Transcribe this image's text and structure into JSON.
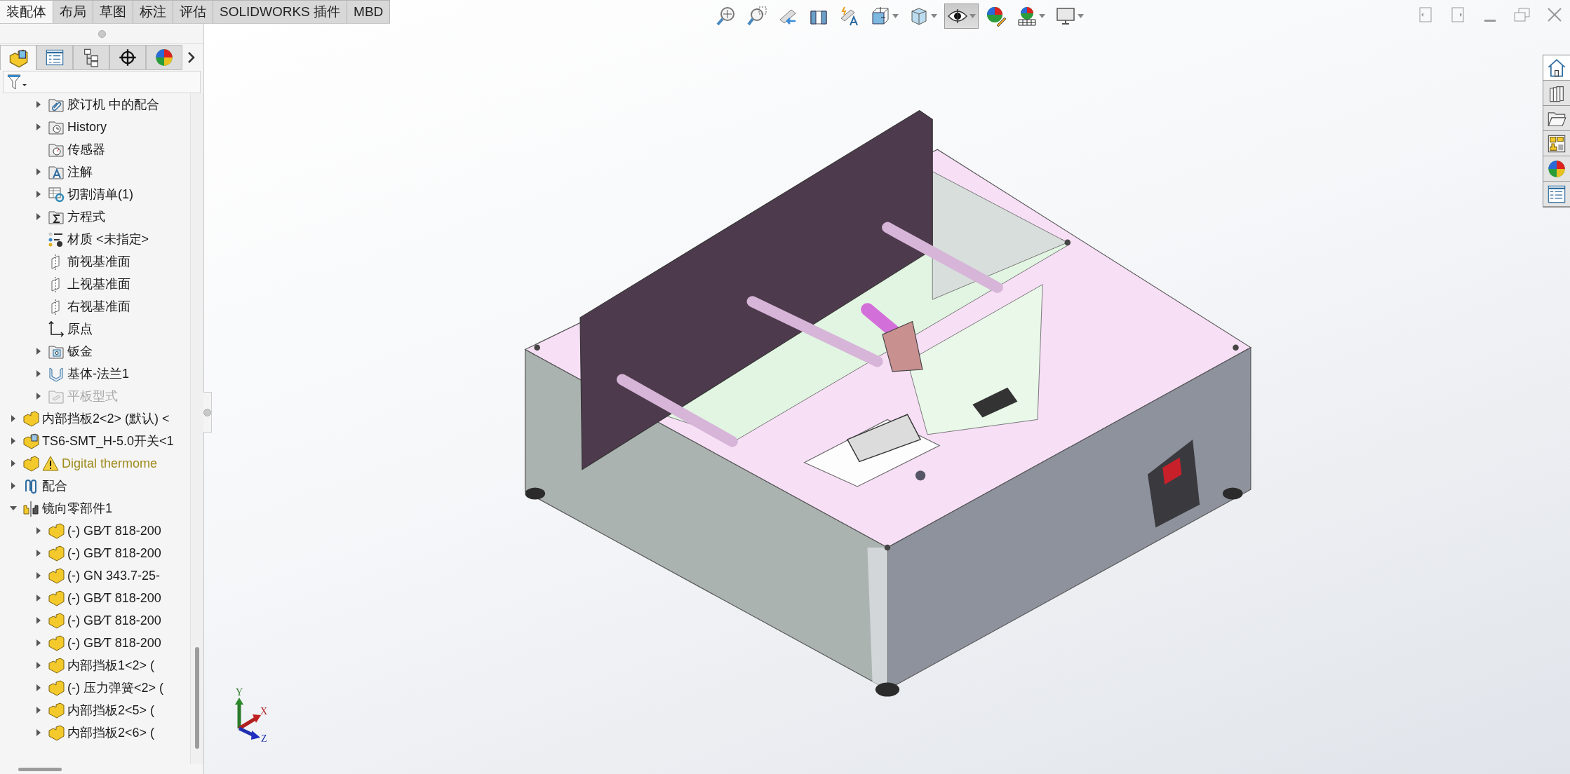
{
  "command_tabs": [
    {
      "label": "装配体",
      "selected": true
    },
    {
      "label": "布局",
      "selected": false
    },
    {
      "label": "草图",
      "selected": false
    },
    {
      "label": "标注",
      "selected": false
    },
    {
      "label": "评估",
      "selected": false
    },
    {
      "label": "SOLIDWORKS 插件",
      "selected": false
    },
    {
      "label": "MBD",
      "selected": false
    }
  ],
  "manager_tabs": [
    {
      "kind": "feature-tree",
      "selected": true
    },
    {
      "kind": "property",
      "selected": false
    },
    {
      "kind": "configuration",
      "selected": false
    },
    {
      "kind": "dimxpert",
      "selected": false
    },
    {
      "kind": "appearance",
      "selected": false
    }
  ],
  "tree": [
    {
      "children": [
        {
          "label": "胶订机 中的配合",
          "kind": "mates-folder",
          "expanded": false
        },
        {
          "label": "History",
          "kind": "history-folder",
          "expanded": false
        },
        {
          "label": "传感器",
          "kind": "sensor-folder"
        },
        {
          "label": "注解",
          "kind": "annotation-folder",
          "expanded": false
        },
        {
          "label": "切割清单(1)",
          "kind": "cutlist",
          "expanded": false
        },
        {
          "label": "方程式",
          "kind": "equations-folder",
          "expanded": false
        },
        {
          "label": "材质 <未指定>",
          "kind": "material"
        },
        {
          "label": "前视基准面",
          "kind": "plane"
        },
        {
          "label": "上视基准面",
          "kind": "plane"
        },
        {
          "label": "右视基准面",
          "kind": "plane"
        },
        {
          "label": "原点",
          "kind": "origin"
        },
        {
          "label": "钣金",
          "kind": "sheetmetal-folder",
          "expanded": false
        },
        {
          "label": "基体-法兰1",
          "kind": "flange",
          "expanded": false
        },
        {
          "label": "平板型式",
          "kind": "flat-pattern",
          "expanded": false,
          "disabled": true
        }
      ]
    },
    {
      "label": "内部挡板2<2> (默认) <",
      "kind": "part",
      "expanded": false
    },
    {
      "label": "TS6-SMT_H-5.0开关<1",
      "kind": "part-cube",
      "expanded": false
    },
    {
      "label": "Digital thermome",
      "kind": "part",
      "expanded": false,
      "warning": true
    },
    {
      "label": "配合",
      "kind": "mates",
      "expanded": false
    },
    {
      "label": "镜向零部件1",
      "kind": "mirror",
      "expanded": true,
      "children": [
        {
          "label": "(-) GB∕T 818-200",
          "kind": "part",
          "expanded": false
        },
        {
          "label": "(-) GB∕T 818-200",
          "kind": "part",
          "expanded": false
        },
        {
          "label": "(-) GN 343.7-25-",
          "kind": "part",
          "expanded": false
        },
        {
          "label": "(-) GB∕T 818-200",
          "kind": "part",
          "expanded": false
        },
        {
          "label": "(-) GB∕T 818-200",
          "kind": "part",
          "expanded": false
        },
        {
          "label": "(-) GB∕T 818-200",
          "kind": "part",
          "expanded": false
        },
        {
          "label": "内部挡板1<2> (",
          "kind": "part",
          "expanded": false
        },
        {
          "label": "(-) 压力弹簧<2> (",
          "kind": "part",
          "expanded": false
        },
        {
          "label": "内部挡板2<5> (",
          "kind": "part",
          "expanded": false
        },
        {
          "label": "内部挡板2<6> (",
          "kind": "part",
          "expanded": false
        }
      ]
    }
  ],
  "view_toolbar": [
    {
      "kind": "zoom-fit",
      "dropdown": false,
      "on": false
    },
    {
      "kind": "zoom-area",
      "dropdown": false,
      "on": false
    },
    {
      "kind": "previous-view",
      "dropdown": false,
      "on": false
    },
    {
      "kind": "section-view",
      "dropdown": false,
      "on": false
    },
    {
      "kind": "dynamic-annotation",
      "dropdown": false,
      "on": false
    },
    {
      "kind": "view-orientation",
      "dropdown": true,
      "on": false
    },
    {
      "kind": "display-style",
      "dropdown": true,
      "on": false
    },
    {
      "kind": "hide-show",
      "dropdown": true,
      "on": true
    },
    {
      "kind": "edit-appearance",
      "dropdown": false,
      "on": false
    },
    {
      "kind": "scene",
      "dropdown": true,
      "on": false
    },
    {
      "kind": "view-settings",
      "dropdown": true,
      "on": false
    }
  ],
  "task_pane_tabs": [
    {
      "kind": "home",
      "selected": true
    },
    {
      "kind": "library",
      "selected": false
    },
    {
      "kind": "explorer",
      "selected": false
    },
    {
      "kind": "palette",
      "selected": false
    },
    {
      "kind": "appearances",
      "selected": false
    },
    {
      "kind": "properties",
      "selected": false
    }
  ],
  "triad": {
    "x": "X",
    "y": "Y",
    "z": "Z"
  }
}
